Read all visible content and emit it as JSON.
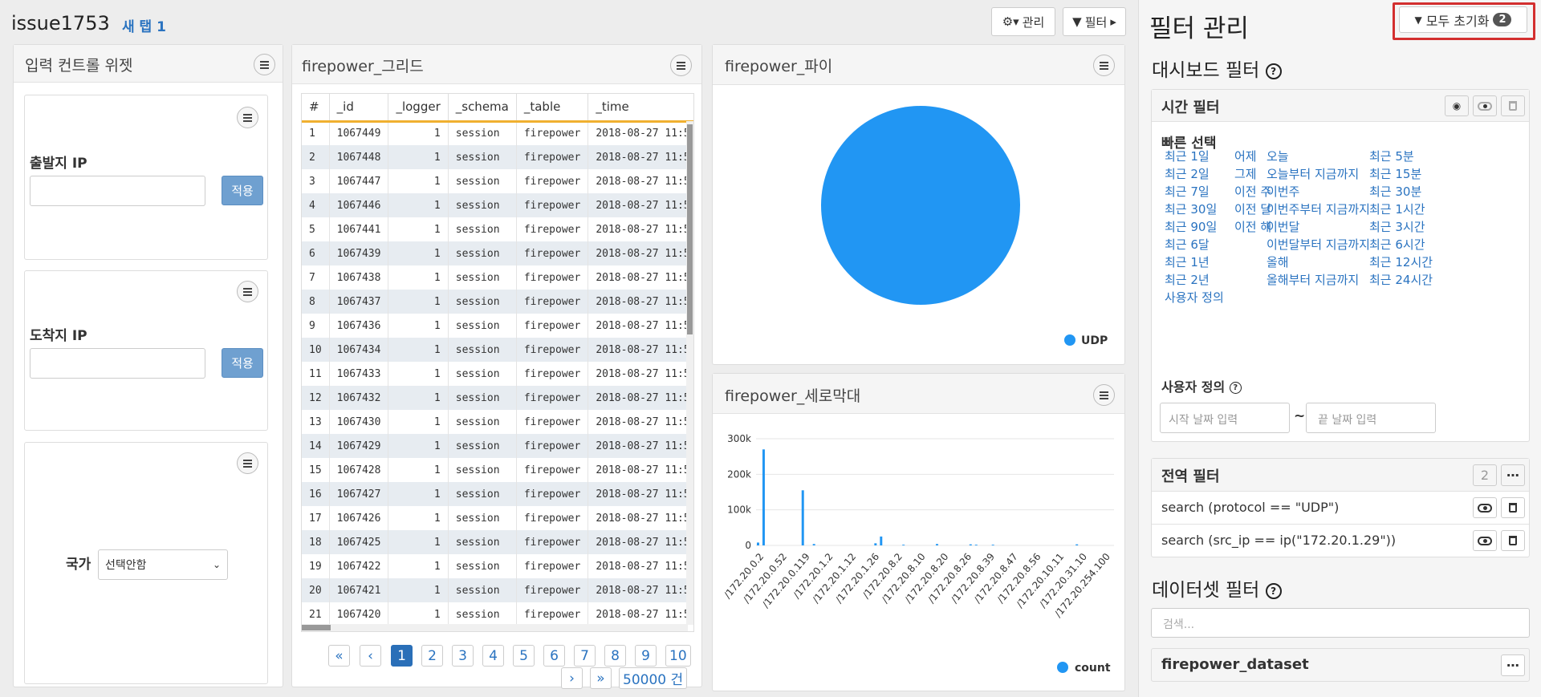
{
  "header": {
    "title": "issue1753",
    "new_tab": "새 탭 1",
    "manage_label": "관리",
    "filter_label": "필터"
  },
  "input_widget": {
    "title": "입력 컨트롤 위젯",
    "source_ip_label": "출발지 IP",
    "dest_ip_label": "도착지 IP",
    "apply_label": "적용",
    "country_label": "국가",
    "country_selected": "선택안함"
  },
  "grid": {
    "title": "firepower_그리드",
    "columns": [
      "#",
      "_id",
      "_logger",
      "_schema",
      "_table",
      "_time"
    ],
    "rows": [
      [
        "1",
        "1067449",
        "1",
        "session",
        "firepower",
        "2018-08-27 11:5"
      ],
      [
        "2",
        "1067448",
        "1",
        "session",
        "firepower",
        "2018-08-27 11:5"
      ],
      [
        "3",
        "1067447",
        "1",
        "session",
        "firepower",
        "2018-08-27 11:5"
      ],
      [
        "4",
        "1067446",
        "1",
        "session",
        "firepower",
        "2018-08-27 11:5"
      ],
      [
        "5",
        "1067441",
        "1",
        "session",
        "firepower",
        "2018-08-27 11:5"
      ],
      [
        "6",
        "1067439",
        "1",
        "session",
        "firepower",
        "2018-08-27 11:5"
      ],
      [
        "7",
        "1067438",
        "1",
        "session",
        "firepower",
        "2018-08-27 11:5"
      ],
      [
        "8",
        "1067437",
        "1",
        "session",
        "firepower",
        "2018-08-27 11:5"
      ],
      [
        "9",
        "1067436",
        "1",
        "session",
        "firepower",
        "2018-08-27 11:5"
      ],
      [
        "10",
        "1067434",
        "1",
        "session",
        "firepower",
        "2018-08-27 11:5"
      ],
      [
        "11",
        "1067433",
        "1",
        "session",
        "firepower",
        "2018-08-27 11:5"
      ],
      [
        "12",
        "1067432",
        "1",
        "session",
        "firepower",
        "2018-08-27 11:5"
      ],
      [
        "13",
        "1067430",
        "1",
        "session",
        "firepower",
        "2018-08-27 11:5"
      ],
      [
        "14",
        "1067429",
        "1",
        "session",
        "firepower",
        "2018-08-27 11:5"
      ],
      [
        "15",
        "1067428",
        "1",
        "session",
        "firepower",
        "2018-08-27 11:5"
      ],
      [
        "16",
        "1067427",
        "1",
        "session",
        "firepower",
        "2018-08-27 11:5"
      ],
      [
        "17",
        "1067426",
        "1",
        "session",
        "firepower",
        "2018-08-27 11:5"
      ],
      [
        "18",
        "1067425",
        "1",
        "session",
        "firepower",
        "2018-08-27 11:5"
      ],
      [
        "19",
        "1067422",
        "1",
        "session",
        "firepower",
        "2018-08-27 11:5"
      ],
      [
        "20",
        "1067421",
        "1",
        "session",
        "firepower",
        "2018-08-27 11:5"
      ],
      [
        "21",
        "1067420",
        "1",
        "session",
        "firepower",
        "2018-08-27 11:5"
      ]
    ],
    "pagination": {
      "first": "«",
      "prev": "‹",
      "pages": [
        "1",
        "2",
        "3",
        "4",
        "5",
        "6",
        "7",
        "8",
        "9",
        "10"
      ],
      "active": "1",
      "next": "›",
      "last": "»",
      "total": "50000 건"
    }
  },
  "pie": {
    "title": "firepower_파이",
    "legend": "UDP",
    "color": "#2196f3"
  },
  "bar": {
    "title": "firepower_세로막대",
    "legend": "count",
    "color": "#2196f3"
  },
  "chart_data": [
    {
      "type": "pie",
      "title": "firepower_파이",
      "categories": [
        "UDP"
      ],
      "values": [
        1
      ],
      "legend": "bottom-right"
    },
    {
      "type": "bar",
      "title": "firepower_세로막대",
      "categories": [
        "/172.20.0.2",
        "",
        "/172.20.0.52",
        "",
        "/172.20.0.119",
        "",
        "/172.20.1.2",
        "",
        "/172.20.1.12",
        "",
        "/172.20.1.26",
        "",
        "/172.20.8.2",
        "",
        "/172.20.8.10",
        "",
        "/172.20.8.20",
        "",
        "/172.20.8.26",
        "",
        "/172.20.8.39",
        "",
        "/172.20.8.47",
        "",
        "/172.20.8.56",
        "",
        "/172.20.10.11",
        "",
        "/172.20.31.10",
        "",
        "/172.20.254.100"
      ],
      "series": [
        {
          "name": "count",
          "values": [
            8000,
            270000,
            0,
            0,
            0,
            0,
            0,
            0,
            155000,
            0,
            4000,
            0,
            0,
            0,
            0,
            0,
            0,
            0,
            0,
            0,
            0,
            6000,
            25000,
            0,
            0,
            0,
            2000,
            0,
            0,
            0,
            0,
            0,
            4000,
            0,
            0,
            0,
            0,
            0,
            3000,
            2000,
            0,
            0,
            2000,
            0,
            0,
            0,
            0,
            0,
            0,
            0,
            0,
            0,
            0,
            0,
            0,
            0,
            0,
            3000,
            0,
            0,
            0,
            0,
            0,
            0
          ]
        }
      ],
      "ylim": [
        0,
        300000
      ],
      "yticks": [
        "0",
        "100k",
        "200k",
        "300k"
      ],
      "legend": "bottom-right",
      "grid": true
    }
  ],
  "filter_panel": {
    "title": "필터 관리",
    "reset_all": "모두 초기화",
    "reset_count": "2",
    "dashboard_filter": "대시보드 필터",
    "time_filter": "시간 필터",
    "quick_select": "빠른 선택",
    "quick_links": [
      [
        "최근 1일",
        "어제",
        "오늘",
        "최근 5분"
      ],
      [
        "최근 2일",
        "그제",
        "오늘부터 지금까지",
        "최근 15분"
      ],
      [
        "최근 7일",
        "이전 주",
        "이번주",
        "최근 30분"
      ],
      [
        "최근 30일",
        "이전 달",
        "이번주부터 지금까지",
        "최근 1시간"
      ],
      [
        "최근 90일",
        "이전 해",
        "이번달",
        "최근 3시간"
      ],
      [
        "최근 6달",
        "",
        "이번달부터 지금까지",
        "최근 6시간"
      ],
      [
        "최근 1년",
        "",
        "올해",
        "최근 12시간"
      ],
      [
        "최근 2년",
        "",
        "올해부터 지금까지",
        "최근 24시간"
      ],
      [
        "사용자 정의",
        "",
        "",
        ""
      ]
    ],
    "custom": "사용자 정의",
    "start_placeholder": "시작 날짜 입력",
    "tilde": "~",
    "end_placeholder": "끝 날짜 입력",
    "global_filter": "전역 필터",
    "global_count": "2",
    "global_items": [
      "search (protocol == \"UDP\")",
      "search (src_ip == ip(\"172.20.1.29\"))"
    ],
    "dataset_filter": "데이터셋 필터",
    "search_placeholder": "검색...",
    "dataset_name": "firepower_dataset"
  }
}
